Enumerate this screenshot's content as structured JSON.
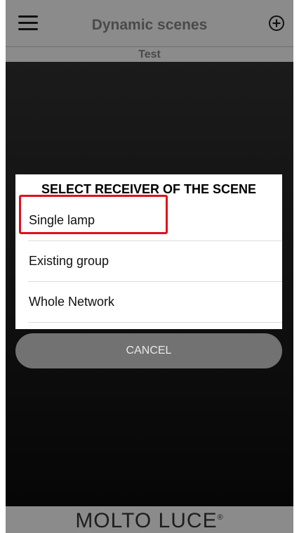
{
  "header": {
    "title": "Dynamic scenes"
  },
  "subheader": {
    "scene_name": "Test"
  },
  "dialog": {
    "title": "SELECT RECEIVER OF THE SCENE",
    "options": [
      {
        "label": "Single lamp"
      },
      {
        "label": "Existing group"
      },
      {
        "label": "Whole Network"
      }
    ],
    "cancel_label": "CANCEL"
  },
  "footer": {
    "brand": "MOLTO LUCE",
    "trademark": "®"
  },
  "colors": {
    "bar_gray": "#8b8b8b",
    "highlight_red": "#e0101a",
    "cancel_gray": "#727272"
  }
}
